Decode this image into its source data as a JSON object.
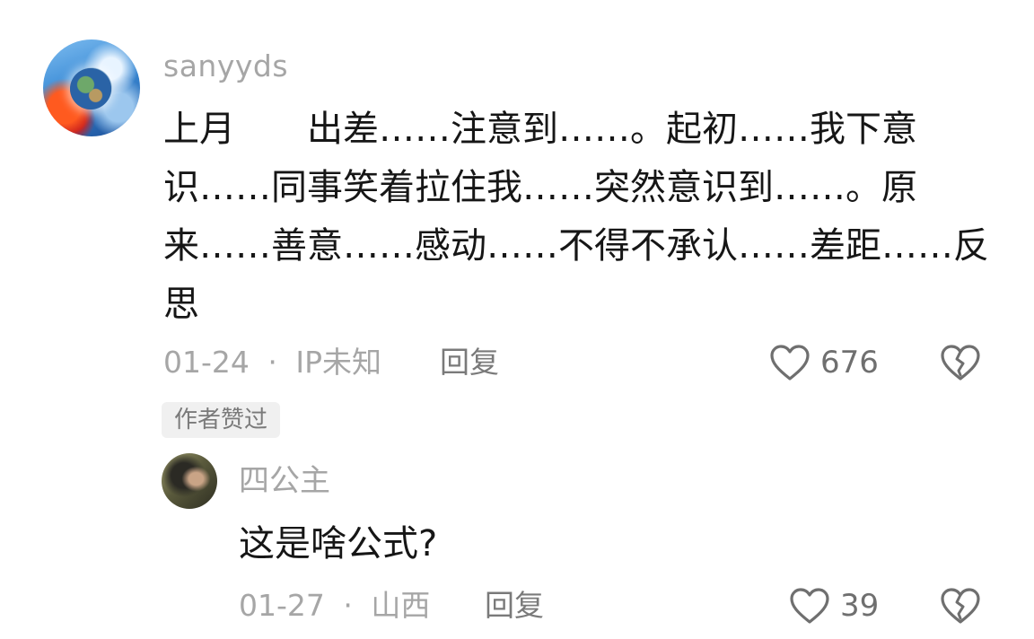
{
  "comment": {
    "username": "sanyyds",
    "text": "上月　　出差……注意到……。起初……我下意识……同事笑着拉住我……突然意识到……。原来……善意……感动……不得不承认……差距……反思",
    "date": "01-24",
    "separator": "·",
    "location": "IP未知",
    "reply_label": "回复",
    "like_count": "676",
    "author_badge": "作者赞过"
  },
  "reply": {
    "username": "四公主",
    "text": "这是啥公式?",
    "date": "01-27",
    "separator": "·",
    "location": "山西",
    "reply_label": "回复",
    "like_count": "39"
  },
  "icons": {
    "like": "heart-outline-icon",
    "dislike": "broken-heart-icon"
  },
  "colors": {
    "text": "#161616",
    "muted": "#a6a6a6",
    "action": "#7a7a7a",
    "badge_bg": "#f0f0f0"
  }
}
